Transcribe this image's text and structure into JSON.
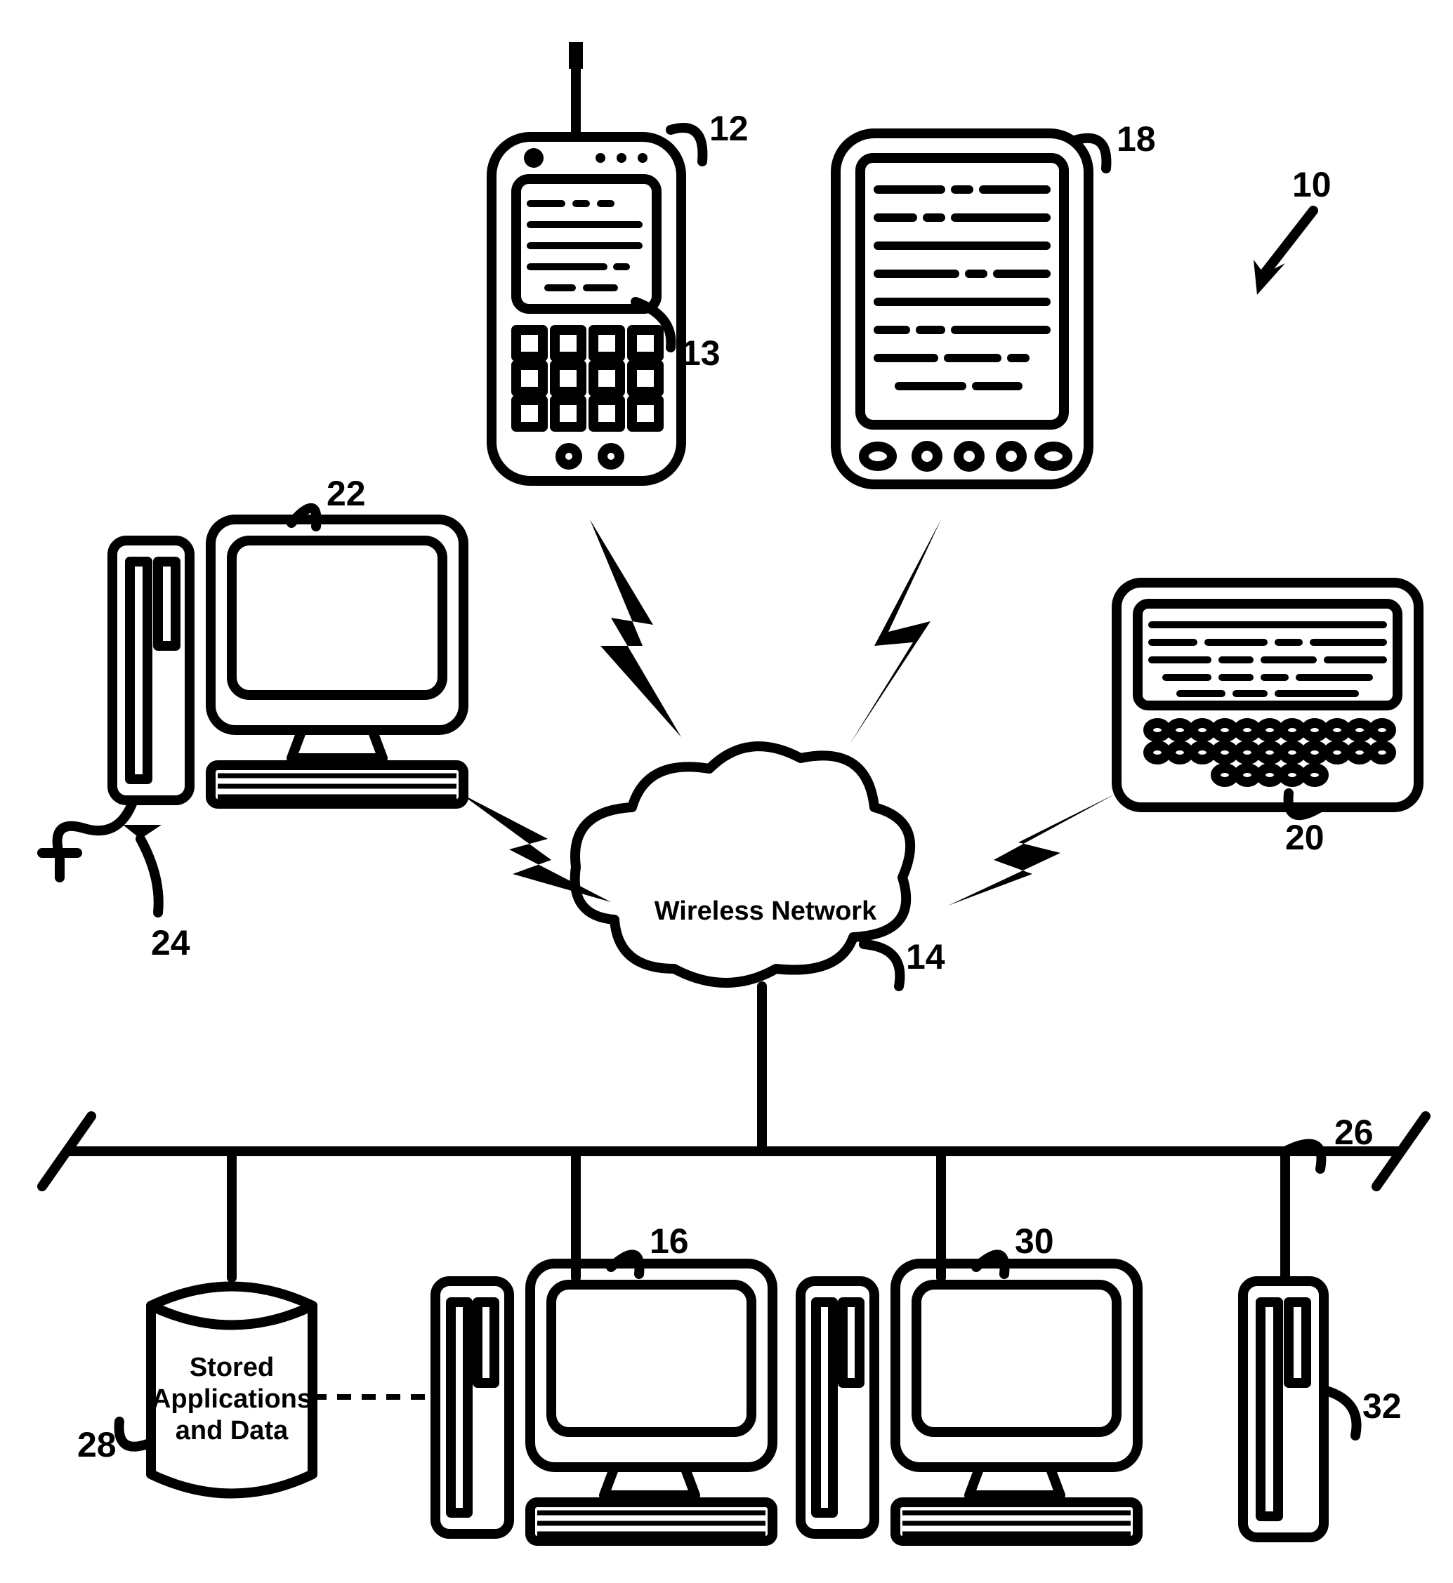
{
  "system_ref": "10",
  "refs": {
    "phone": "12",
    "phone_screen": "13",
    "pda": "18",
    "texter": "20",
    "desktop_left": "22",
    "desktop_left_cable": "24",
    "cloud": "14",
    "cloud_label": "Wireless Network",
    "bus": "26",
    "db": "28",
    "db_text": [
      "Stored",
      "Applications",
      "and Data"
    ],
    "server_mid": "16",
    "server_right": "30",
    "tower_right": "32"
  }
}
